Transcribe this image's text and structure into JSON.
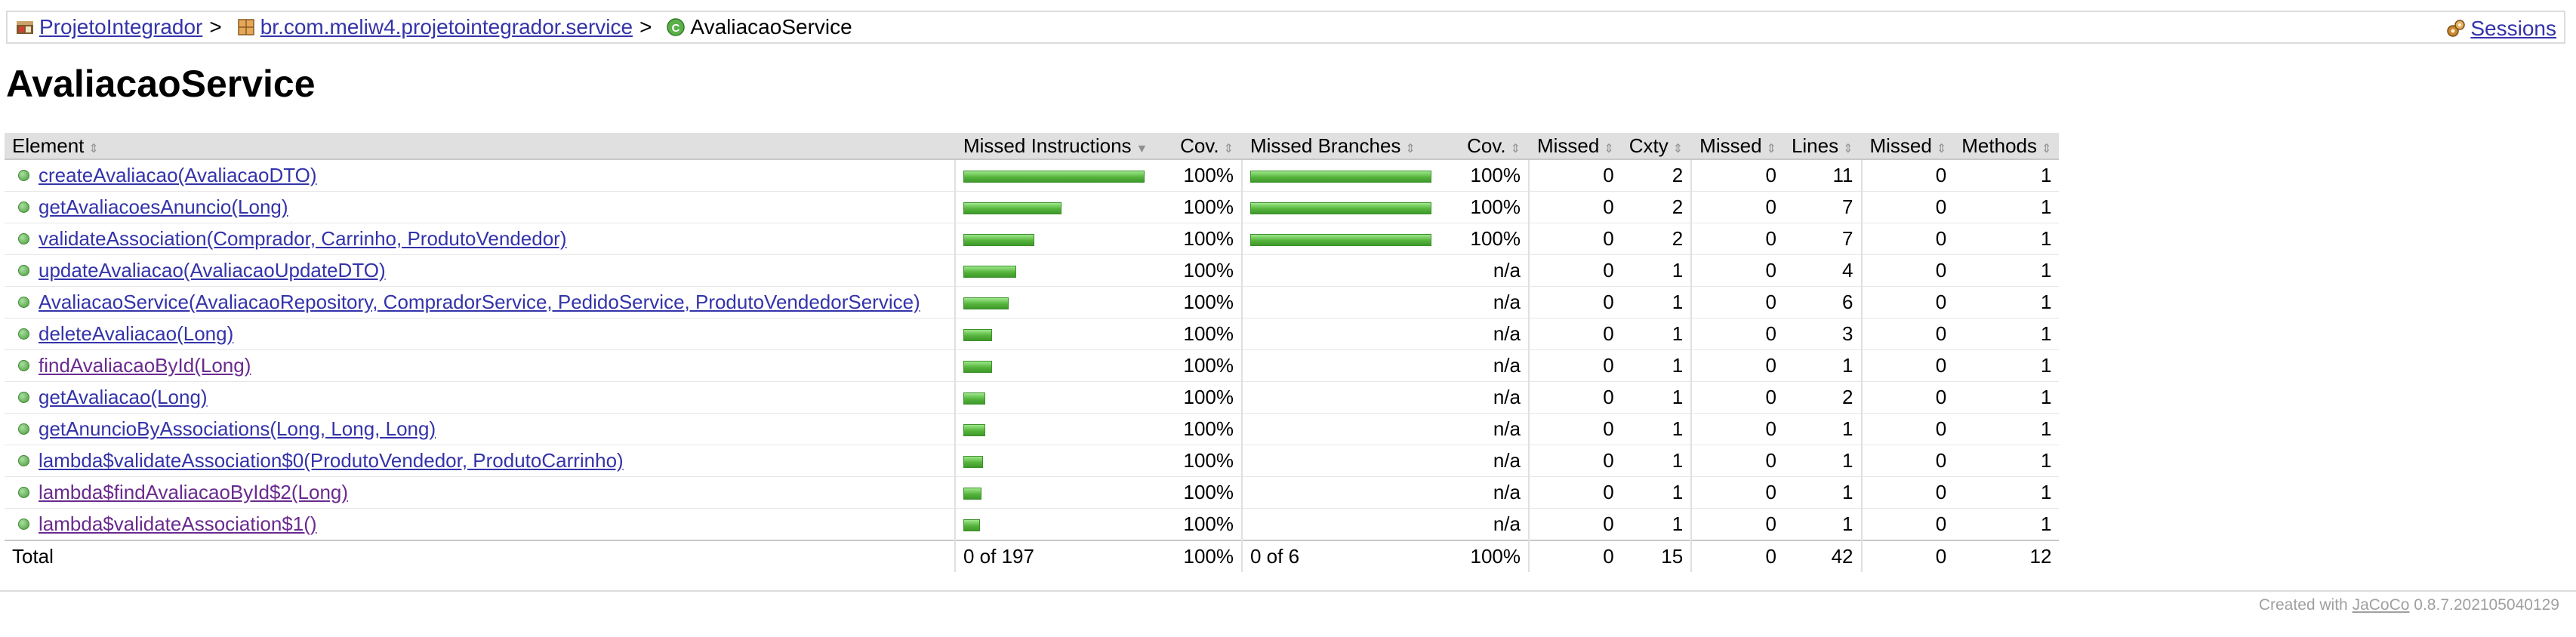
{
  "breadcrumb": {
    "project": "ProjetoIntegrador",
    "package": "br.com.meliw4.projetointegrador.service",
    "class": "AvaliacaoService",
    "separator": ">",
    "sessions": "Sessions"
  },
  "title": "AvaliacaoService",
  "columns": {
    "element": "Element",
    "missed_instructions": "Missed Instructions",
    "cov1": "Cov.",
    "missed_branches": "Missed Branches",
    "cov2": "Cov.",
    "missed_cxty": "Missed",
    "cxty": "Cxty",
    "missed_lines": "Missed",
    "lines": "Lines",
    "missed_methods": "Missed",
    "methods": "Methods"
  },
  "rows": [
    {
      "name": "createAvaliacao(AvaliacaoDTO)",
      "visited": false,
      "instr_fraction": 1.0,
      "instr_cov": "100%",
      "branch_fraction": 1.0,
      "branch_cov": "100%",
      "missed_cxty": "0",
      "cxty": "2",
      "missed_lines": "0",
      "lines": "11",
      "missed_methods": "0",
      "methods": "1"
    },
    {
      "name": "getAvaliacoesAnuncio(Long)",
      "visited": false,
      "instr_fraction": 0.54,
      "instr_cov": "100%",
      "branch_fraction": 1.0,
      "branch_cov": "100%",
      "missed_cxty": "0",
      "cxty": "2",
      "missed_lines": "0",
      "lines": "7",
      "missed_methods": "0",
      "methods": "1"
    },
    {
      "name": "validateAssociation(Comprador, Carrinho, ProdutoVendedor)",
      "visited": false,
      "instr_fraction": 0.39,
      "instr_cov": "100%",
      "branch_fraction": 1.0,
      "branch_cov": "100%",
      "missed_cxty": "0",
      "cxty": "2",
      "missed_lines": "0",
      "lines": "7",
      "missed_methods": "0",
      "methods": "1"
    },
    {
      "name": "updateAvaliacao(AvaliacaoUpdateDTO)",
      "visited": false,
      "instr_fraction": 0.29,
      "instr_cov": "100%",
      "branch_fraction": 0,
      "branch_cov": "n/a",
      "missed_cxty": "0",
      "cxty": "1",
      "missed_lines": "0",
      "lines": "4",
      "missed_methods": "0",
      "methods": "1"
    },
    {
      "name": "AvaliacaoService(AvaliacaoRepository, CompradorService, PedidoService, ProdutoVendedorService)",
      "visited": false,
      "instr_fraction": 0.25,
      "instr_cov": "100%",
      "branch_fraction": 0,
      "branch_cov": "n/a",
      "missed_cxty": "0",
      "cxty": "1",
      "missed_lines": "0",
      "lines": "6",
      "missed_methods": "0",
      "methods": "1"
    },
    {
      "name": "deleteAvaliacao(Long)",
      "visited": false,
      "instr_fraction": 0.16,
      "instr_cov": "100%",
      "branch_fraction": 0,
      "branch_cov": "n/a",
      "missed_cxty": "0",
      "cxty": "1",
      "missed_lines": "0",
      "lines": "3",
      "missed_methods": "0",
      "methods": "1"
    },
    {
      "name": "findAvaliacaoById(Long)",
      "visited": true,
      "instr_fraction": 0.16,
      "instr_cov": "100%",
      "branch_fraction": 0,
      "branch_cov": "n/a",
      "missed_cxty": "0",
      "cxty": "1",
      "missed_lines": "0",
      "lines": "1",
      "missed_methods": "0",
      "methods": "1"
    },
    {
      "name": "getAvaliacao(Long)",
      "visited": false,
      "instr_fraction": 0.12,
      "instr_cov": "100%",
      "branch_fraction": 0,
      "branch_cov": "n/a",
      "missed_cxty": "0",
      "cxty": "1",
      "missed_lines": "0",
      "lines": "2",
      "missed_methods": "0",
      "methods": "1"
    },
    {
      "name": "getAnuncioByAssociations(Long, Long, Long)",
      "visited": false,
      "instr_fraction": 0.12,
      "instr_cov": "100%",
      "branch_fraction": 0,
      "branch_cov": "n/a",
      "missed_cxty": "0",
      "cxty": "1",
      "missed_lines": "0",
      "lines": "1",
      "missed_methods": "0",
      "methods": "1"
    },
    {
      "name": "lambda$validateAssociation$0(ProdutoVendedor, ProdutoCarrinho)",
      "visited": false,
      "instr_fraction": 0.11,
      "instr_cov": "100%",
      "branch_fraction": 0,
      "branch_cov": "n/a",
      "missed_cxty": "0",
      "cxty": "1",
      "missed_lines": "0",
      "lines": "1",
      "missed_methods": "0",
      "methods": "1"
    },
    {
      "name": "lambda$findAvaliacaoById$2(Long)",
      "visited": true,
      "instr_fraction": 0.1,
      "instr_cov": "100%",
      "branch_fraction": 0,
      "branch_cov": "n/a",
      "missed_cxty": "0",
      "cxty": "1",
      "missed_lines": "0",
      "lines": "1",
      "missed_methods": "0",
      "methods": "1"
    },
    {
      "name": "lambda$validateAssociation$1()",
      "visited": true,
      "instr_fraction": 0.09,
      "instr_cov": "100%",
      "branch_fraction": 0,
      "branch_cov": "n/a",
      "missed_cxty": "0",
      "cxty": "1",
      "missed_lines": "0",
      "lines": "1",
      "missed_methods": "0",
      "methods": "1"
    }
  ],
  "total": {
    "label": "Total",
    "instructions": "0 of 197",
    "instr_cov": "100%",
    "branches": "0 of 6",
    "branch_cov": "100%",
    "missed_cxty": "0",
    "cxty": "15",
    "missed_lines": "0",
    "lines": "42",
    "missed_methods": "0",
    "methods": "12"
  },
  "footer": {
    "prefix": "Created with",
    "link": "JaCoCo",
    "version": "0.8.7.202105040129"
  }
}
